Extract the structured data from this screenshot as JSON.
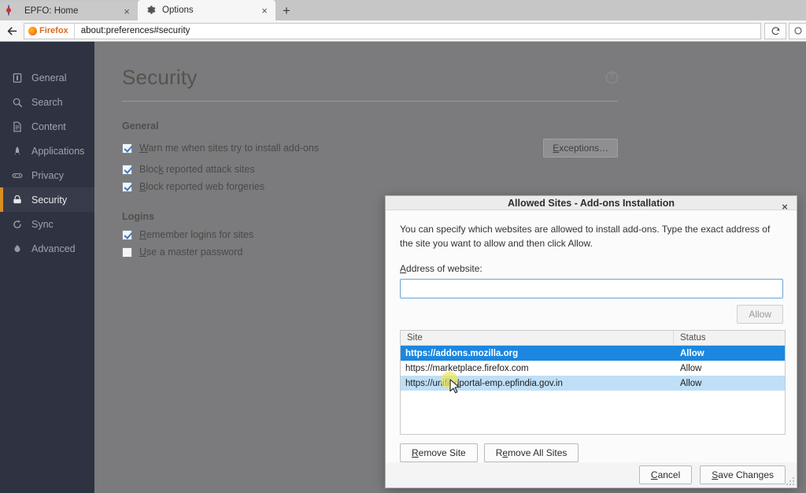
{
  "browser": {
    "tabs": [
      {
        "title": "EPFO: Home",
        "icon": "epfo-favicon",
        "active": false,
        "close_label": "×"
      },
      {
        "title": "Options",
        "icon": "gear-icon",
        "active": true,
        "close_label": "×"
      }
    ],
    "new_tab_label": "+",
    "back_label": "←",
    "url": "about:preferences#security",
    "identity_badge": "Firefox",
    "reload_label": "↻",
    "toolbar_extra_label": "○"
  },
  "sidebar": {
    "items": [
      {
        "label": "General",
        "icon": "general-icon",
        "selected": false
      },
      {
        "label": "Search",
        "icon": "search-icon",
        "selected": false
      },
      {
        "label": "Content",
        "icon": "content-icon",
        "selected": false
      },
      {
        "label": "Applications",
        "icon": "applications-icon",
        "selected": false
      },
      {
        "label": "Privacy",
        "icon": "privacy-mask-icon",
        "selected": false
      },
      {
        "label": "Security",
        "icon": "lock-icon",
        "selected": true
      },
      {
        "label": "Sync",
        "icon": "sync-icon",
        "selected": false
      },
      {
        "label": "Advanced",
        "icon": "advanced-icon",
        "selected": false
      }
    ]
  },
  "prefs": {
    "page_title": "Security",
    "help_icon_label": "?",
    "groups": [
      {
        "heading": "General",
        "options": [
          {
            "label": "Warn me when sites try to install add-ons",
            "accesskey": "W",
            "checked": true,
            "button": "Exceptions…"
          },
          {
            "label": "Block reported attack sites",
            "accesskey": "k",
            "checked": true
          },
          {
            "label": "Block reported web forgeries",
            "accesskey": "B",
            "checked": true
          }
        ]
      },
      {
        "heading": "Logins",
        "options": [
          {
            "label": "Remember logins for sites",
            "accesskey": "R",
            "checked": true
          },
          {
            "label": "Use a master password",
            "accesskey": "U",
            "checked": false
          }
        ]
      }
    ]
  },
  "dialog": {
    "title": "Allowed Sites - Add-ons Installation",
    "close_label": "×",
    "description": "You can specify which websites are allowed to install add-ons. Type the exact address of the site you want to allow and then click Allow.",
    "address_label": "Address of website:",
    "address_value": "",
    "address_placeholder": "",
    "allow_button": "Allow",
    "allow_enabled": false,
    "table": {
      "columns": [
        "Site",
        "Status"
      ],
      "rows": [
        {
          "site": "https://addons.mozilla.org",
          "status": "Allow",
          "state": "selected"
        },
        {
          "site": "https://marketplace.firefox.com",
          "status": "Allow",
          "state": "normal"
        },
        {
          "site": "https://unifiedportal-emp.epfindia.gov.in",
          "status": "Allow",
          "state": "hovered"
        }
      ]
    },
    "remove_site_button": "Remove Site",
    "remove_site_accesskey": "R",
    "remove_all_button": "Remove All Sites",
    "remove_all_accesskey": "e",
    "cancel_button": "Cancel",
    "cancel_accesskey": "C",
    "save_button": "Save Changes",
    "save_accesskey": "S"
  },
  "colors": {
    "sidebar_bg": "#2f3341",
    "sidebar_selected_bg": "#383c4a",
    "sidebar_accent": "#d98f20",
    "row_selected_bg": "#1b87e0",
    "row_hover_bg": "#bfdff7",
    "input_focus_border": "#6da3d4",
    "checkbox_check": "#3a77c4",
    "dimmed_page_bg": "#7b7b7d"
  }
}
